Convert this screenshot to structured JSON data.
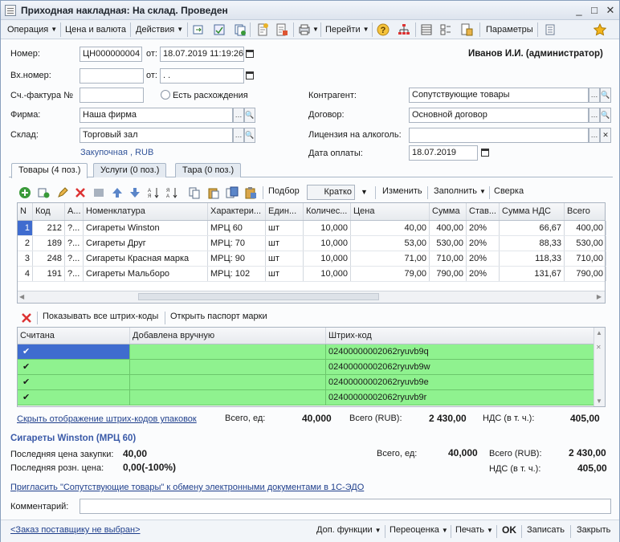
{
  "window": {
    "title": "Приходная накладная: На склад. Проведен",
    "controls": [
      "_",
      "□",
      "✕"
    ]
  },
  "toolbar": {
    "operation": "Операция",
    "price_currency": "Цена и валюта",
    "actions": "Действия",
    "goto": "Перейти",
    "parameters": "Параметры"
  },
  "header": {
    "number_label": "Номер:",
    "number_value": "ЦН000000004",
    "from_label": "от:",
    "date_value": "18.07.2019 11:19:26",
    "user": "Иванов И.И. (администратор)",
    "in_number_label": "Вх.номер:",
    "in_number_value": "",
    "in_from_label": "от:",
    "in_date_value": " .  .",
    "invoice_label": "Сч.-фактура №",
    "invoice_value": "",
    "discrepancy_label": "Есть расхождения",
    "firm_label": "Фирма:",
    "firm_value": "Наша фирма",
    "warehouse_label": "Склад:",
    "warehouse_value": "Торговый зал",
    "price_type_link": "Закупочная , RUB",
    "contractor_label": "Контрагент:",
    "contractor_value": "Сопутствующие товары",
    "contract_label": "Договор:",
    "contract_value": "Основной договор",
    "license_label": "Лицензия на алкоголь:",
    "license_value": "",
    "pay_date_label": "Дата оплаты:",
    "pay_date_value": "18.07.2019"
  },
  "tabs": [
    {
      "label": "Товары (4 поз.)"
    },
    {
      "label": "Услуги (0 поз.)"
    },
    {
      "label": "Тара (0 поз.)"
    }
  ],
  "grid_toolbar": {
    "pick": "Подбор",
    "view": "Кратко",
    "change": "Изменить",
    "fill": "Заполнить",
    "compare": "Сверка"
  },
  "goods_table": {
    "columns": [
      "N",
      "Код",
      "А...",
      "Номенклатура",
      "Характери...",
      "Един...",
      "Количес...",
      "Цена",
      "Сумма",
      "Став...",
      "Сумма НДС",
      "Всего"
    ],
    "rows": [
      {
        "n": "1",
        "code": "212",
        "a": "?...",
        "name": "Сигареты Winston",
        "char": "МРЦ 60",
        "unit": "шт",
        "qty": "10,000",
        "price": "40,00",
        "sum": "400,00",
        "rate": "20%",
        "vat": "66,67",
        "total": "400,00"
      },
      {
        "n": "2",
        "code": "189",
        "a": "?...",
        "name": "Сигареты Друг",
        "char": "МРЦ: 70",
        "unit": "шт",
        "qty": "10,000",
        "price": "53,00",
        "sum": "530,00",
        "rate": "20%",
        "vat": "88,33",
        "total": "530,00"
      },
      {
        "n": "3",
        "code": "248",
        "a": "?...",
        "name": "Сигареты Красная марка",
        "char": "МРЦ: 90",
        "unit": "шт",
        "qty": "10,000",
        "price": "71,00",
        "sum": "710,00",
        "rate": "20%",
        "vat": "118,33",
        "total": "710,00"
      },
      {
        "n": "4",
        "code": "191",
        "a": "?...",
        "name": "Сигареты Мальборо",
        "char": "МРЦ: 102",
        "unit": "шт",
        "qty": "10,000",
        "price": "79,00",
        "sum": "790,00",
        "rate": "20%",
        "vat": "131,67",
        "total": "790,00"
      }
    ]
  },
  "barcode_toolbar": {
    "show_all": "Показывать все штрих-коды",
    "open_passport": "Открыть паспорт марки"
  },
  "barcode_table": {
    "columns": [
      "Считана",
      "Добавлена вручную",
      "Штрих-код"
    ],
    "rows": [
      {
        "read": "✔",
        "manual": "",
        "code": "02400000002062ryuvb9q"
      },
      {
        "read": "✔",
        "manual": "",
        "code": "02400000002062ryuvb9w"
      },
      {
        "read": "✔",
        "manual": "",
        "code": "02400000002062ryuvb9e"
      },
      {
        "read": "✔",
        "manual": "",
        "code": "02400000002062ryuvb9r"
      }
    ]
  },
  "barcode_totals": {
    "hide_link": "Скрыть отображение штрих-кодов упаковок",
    "total_units_label": "Всего, ед:",
    "total_units_value": "40,000",
    "total_rub_label": "Всего (RUB):",
    "total_rub_value": "2 430,00",
    "vat_label": "НДС (в т. ч.):",
    "vat_value": "405,00"
  },
  "item_info": {
    "title": "Сигареты Winston (МРЦ 60)",
    "last_purchase_label": "Последняя цена закупки:",
    "last_purchase_value": "40,00",
    "last_retail_label": "Последняя розн. цена:",
    "last_retail_value": "0,00(-100%)",
    "total_units_label": "Всего, ед:",
    "total_units_value": "40,000",
    "total_rub_label": "Всего (RUB):",
    "total_rub_value": "2 430,00",
    "vat_label": "НДС (в т. ч.):",
    "vat_value": "405,00"
  },
  "edo_link": "Пригласить \"Сопутствующие товары\" к обмену электронными документами в 1С-ЭДО",
  "comment": {
    "label": "Комментарий:",
    "value": ""
  },
  "footer": {
    "order_link": "<Заказ поставщику не выбран>",
    "extra_functions": "Доп. функции",
    "revaluation": "Переоценка",
    "print": "Печать",
    "ok": "OK",
    "save": "Записать",
    "close": "Закрыть"
  },
  "colors": {
    "barcode_row_bg": "#8ff28f",
    "selected_cell": "#3f6ccf",
    "link": "#1f3f8c"
  }
}
